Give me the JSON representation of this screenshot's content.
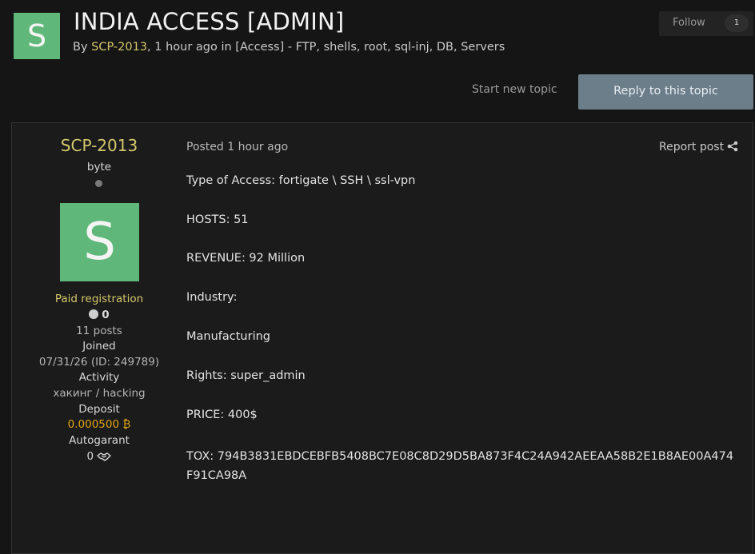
{
  "header": {
    "avatar_letter": "S",
    "title": "INDIA ACCESS [ADMIN]",
    "by_label": "By",
    "author": "SCP-2013",
    "meta": ", 1 hour ago in [Access] - FTP, shells, root, sql-inj, DB, Servers",
    "follow_label": "Follow",
    "follow_count": "1",
    "start_topic_label": "Start new topic",
    "reply_label": "Reply to this topic"
  },
  "author_panel": {
    "name": "SCP-2013",
    "rank": "byte",
    "avatar_letter": "S",
    "group": "Paid registration",
    "reputation": "0",
    "posts": "11 posts",
    "joined_label": "Joined",
    "joined_value": "07/31/26 (ID: 249789)",
    "activity_label": "Activity",
    "activity_value": "хакинг / hacking",
    "deposit_label": "Deposit",
    "deposit_value": "0.000500",
    "deposit_symbol": "₿",
    "autogarant_label": "Autogarant",
    "autogarant_value": "0"
  },
  "post": {
    "posted_label": "Posted",
    "posted_time": "1 hour ago",
    "report_label": "Report post",
    "lines": [
      "Type of Access: fortigate \\ SSH \\ ssl-vpn",
      "HOSTS: 51",
      "REVENUE: 92 Million",
      "Industry:",
      "Manufacturing",
      "Rights: super_admin",
      "PRICE: 400$"
    ],
    "tox": "TOX: 794B3831EBDCEBFB5408BC7E08C8D29D5BA873F4C24A942AEEAA58B2E1B8AE00A474F91CA98A"
  },
  "colors": {
    "background": "#151515",
    "accent_gold": "#d5c86b",
    "avatar_green": "#5fb87a",
    "reply_button": "#6c7e8a",
    "deposit_orange": "#e2a812"
  }
}
